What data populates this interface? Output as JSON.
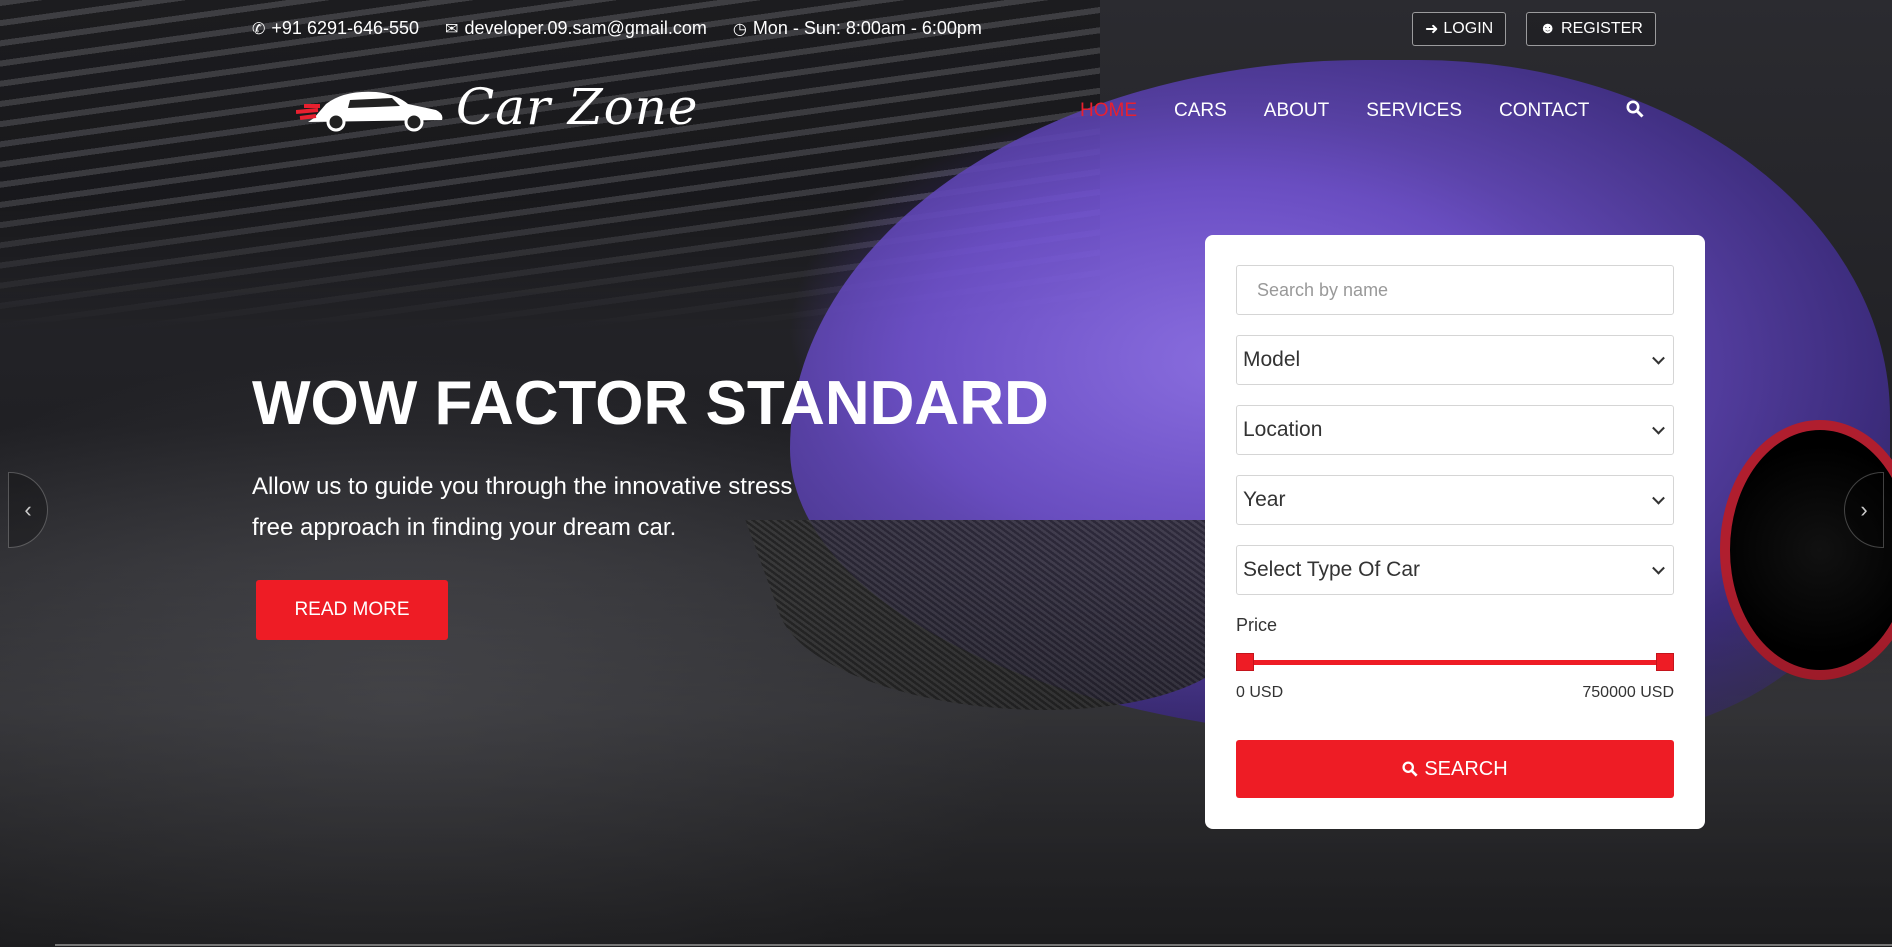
{
  "topbar": {
    "phone_icon": "phone-icon",
    "phone": "+91 6291-646-550",
    "email_icon": "envelope-icon",
    "email": "developer.09.sam@gmail.com",
    "hours_icon": "clock-icon",
    "hours": "Mon - Sun: 8:00am - 6:00pm"
  },
  "auth": {
    "login_label": "LOGIN",
    "register_label": "REGISTER"
  },
  "logo": {
    "text": "Car Zone",
    "icon": "car-logo-icon"
  },
  "nav": {
    "items": [
      {
        "label": "HOME",
        "active": true
      },
      {
        "label": "CARS",
        "active": false
      },
      {
        "label": "ABOUT",
        "active": false
      },
      {
        "label": "SERVICES",
        "active": false
      },
      {
        "label": "CONTACT",
        "active": false
      }
    ],
    "search_icon": "search-icon"
  },
  "hero": {
    "headline": "WOW FACTOR STANDARD",
    "subtext": "Allow us to guide you through the innovative stress free approach in finding your dream car.",
    "cta_label": "READ MORE"
  },
  "search_panel": {
    "name_placeholder": "Search by name",
    "model": "Model",
    "location": "Location",
    "year": "Year",
    "type": "Select Type Of Car",
    "price_label": "Price",
    "price_min": "0 USD",
    "price_max": "750000 USD",
    "price_low_fraction": 0,
    "price_high_fraction": 1,
    "search_label": "SEARCH"
  },
  "colors": {
    "accent": "#ee1c25",
    "active_nav": "#e8202f"
  }
}
